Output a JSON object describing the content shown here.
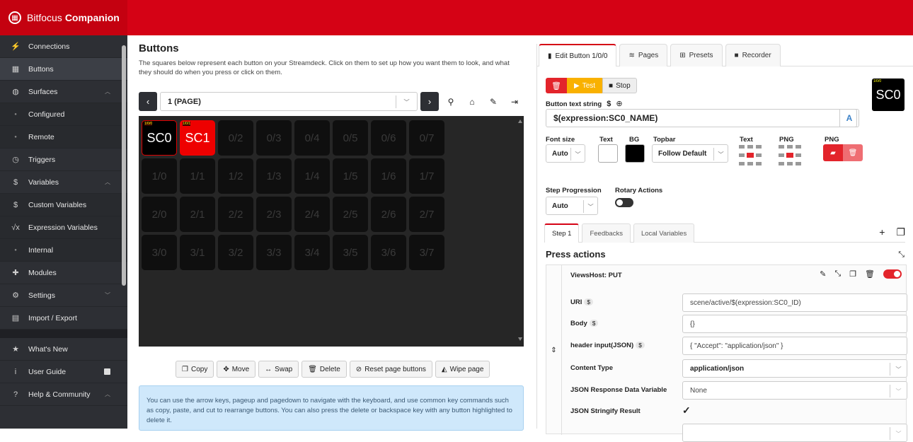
{
  "app": {
    "brand_light": "Bitfocus",
    "brand_bold": "Companion"
  },
  "sidebar": {
    "items": [
      {
        "label": "Connections",
        "icon": "plug-icon"
      },
      {
        "label": "Buttons",
        "icon": "grid-icon"
      },
      {
        "label": "Surfaces",
        "icon": "gamepad-icon"
      },
      {
        "label": "Configured",
        "icon": "dot-icon"
      },
      {
        "label": "Remote",
        "icon": "dot-icon"
      },
      {
        "label": "Triggers",
        "icon": "clock-icon"
      },
      {
        "label": "Variables",
        "icon": "dollar-icon"
      },
      {
        "label": "Custom Variables",
        "icon": "dollar-icon"
      },
      {
        "label": "Expression Variables",
        "icon": "sqrt-icon"
      },
      {
        "label": "Internal",
        "icon": "dot-icon"
      },
      {
        "label": "Modules",
        "icon": "puzzle-icon"
      },
      {
        "label": "Settings",
        "icon": "gears-icon"
      },
      {
        "label": "Import / Export",
        "icon": "file-icon"
      }
    ],
    "bottom": [
      {
        "label": "What's New",
        "icon": "star-icon"
      },
      {
        "label": "User Guide",
        "icon": "info-icon"
      },
      {
        "label": "Help & Community",
        "icon": "question-icon"
      }
    ]
  },
  "buttons_panel": {
    "title": "Buttons",
    "description": "The squares below represent each button on your Streamdeck. Click on them to set up how you want them to look, and what they should do when you press or click on them.",
    "page_label": "1 (PAGE)",
    "cells": [
      "SC0",
      "SC1",
      "0/2",
      "0/3",
      "0/4",
      "0/5",
      "0/6",
      "0/7",
      "1/0",
      "1/1",
      "1/2",
      "1/3",
      "1/4",
      "1/5",
      "1/6",
      "1/7",
      "2/0",
      "2/1",
      "2/2",
      "2/3",
      "2/4",
      "2/5",
      "2/6",
      "2/7",
      "3/0",
      "3/1",
      "3/2",
      "3/3",
      "3/4",
      "3/5",
      "3/6",
      "3/7"
    ],
    "cell_tiny": [
      "1/0/0",
      "1/0/1"
    ],
    "actions": [
      "Copy",
      "Move",
      "Swap",
      "Delete",
      "Reset page buttons",
      "Wipe page"
    ],
    "hint": "You can use the arrow keys, pageup and pagedown to navigate with the keyboard, and use common key commands such as copy, paste, and cut to rearrange buttons. You can also press the delete or backspace key with any button highlighted to delete it."
  },
  "editor": {
    "tabs": [
      "Edit Button 1/0/0",
      "Pages",
      "Presets",
      "Recorder"
    ],
    "test_label": "Test",
    "stop_label": "Stop",
    "preview_text": "SC0",
    "preview_tiny": "1/0/0",
    "text_string_label": "Button text string",
    "text_string_value": "$(expression:SC0_NAME)",
    "text_A": "A",
    "font_size_label": "Font size",
    "font_size_value": "Auto",
    "text_color_label": "Text",
    "bg_label": "BG",
    "topbar_label": "Topbar",
    "topbar_value": "Follow Default",
    "text_align_label": "Text",
    "png_align_label": "PNG",
    "png_label": "PNG",
    "text_color": "#ffffff",
    "bg_color": "#000000",
    "step_progression_label": "Step Progression",
    "step_progression_value": "Auto",
    "rotary_label": "Rotary Actions",
    "subtabs": [
      "Step 1",
      "Feedbacks",
      "Local Variables"
    ],
    "press_actions_label": "Press actions",
    "action": {
      "title": "ViewsHost: PUT",
      "fields": [
        {
          "label": "URI",
          "dollar": "$",
          "value": "scene/active/$(expression:SC0_ID)",
          "type": "text"
        },
        {
          "label": "Body",
          "dollar": "$",
          "value": "{}",
          "type": "text"
        },
        {
          "label": "header input(JSON)",
          "dollar": "$",
          "value": "{ \"Accept\": \"application/json\" }",
          "type": "text"
        },
        {
          "label": "Content Type",
          "dollar": "",
          "value": "application/json",
          "type": "select"
        },
        {
          "label": "JSON Response Data Variable",
          "dollar": "",
          "value": "None",
          "type": "select"
        },
        {
          "label": "JSON Stringify Result",
          "dollar": "",
          "value": "✓",
          "type": "check"
        }
      ]
    }
  },
  "colors": {
    "accent": "#d50215",
    "sidebar": "#2d2f34",
    "test": "#f9b100"
  }
}
